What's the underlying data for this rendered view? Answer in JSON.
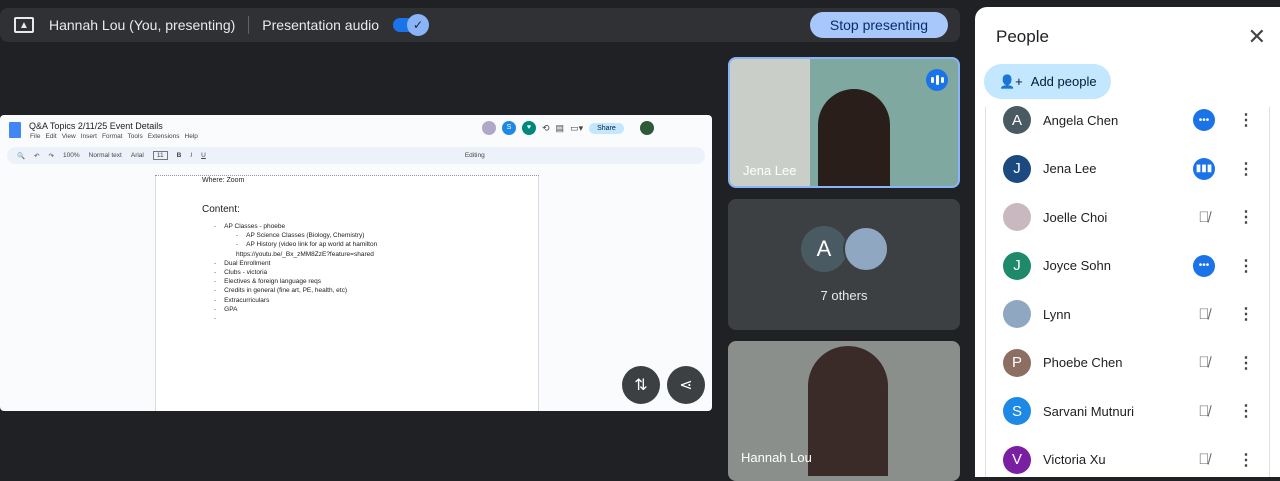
{
  "topbar": {
    "presenter": "Hannah Lou (You, presenting)",
    "audio_label": "Presentation audio",
    "audio_on": true,
    "stop_label": "Stop presenting"
  },
  "doc": {
    "title": "Q&A Topics 2/11/25 Event Details",
    "menus": [
      "File",
      "Edit",
      "View",
      "Insert",
      "Format",
      "Tools",
      "Extensions",
      "Help"
    ],
    "zoom": "100%",
    "style": "Normal text",
    "font": "Arial",
    "font_size": "11",
    "mode": "Editing",
    "share": "Share",
    "collab_initial": "S",
    "where": "Where: Zoom",
    "heading": "Content:",
    "items": [
      {
        "text": "AP Classes - phoebe",
        "level": 1
      },
      {
        "text": "AP Science Classes (Biology, Chemistry)",
        "level": 2
      },
      {
        "text": "AP History (video link for ap world at hamilton",
        "level": 2
      },
      {
        "text": "https://youtu.be/_Bx_zMM8ZzE?feature=shared",
        "level": "cont"
      },
      {
        "text": "Dual Enrollment",
        "level": 1
      },
      {
        "text": "Clubs - victoria",
        "level": 1
      },
      {
        "text": "Electives & foreign language reqs",
        "level": 1
      },
      {
        "text": "Credits in general (fine art, PE, health, etc)",
        "level": 1
      },
      {
        "text": "Extracurriculars",
        "level": 1
      },
      {
        "text": "GPA",
        "level": 1
      },
      {
        "text": "",
        "level": 1
      }
    ]
  },
  "tiles": {
    "jena": "Jena Lee",
    "others_initial": "A",
    "others": "7 others",
    "hannah": "Hannah Lou"
  },
  "panel": {
    "title": "People",
    "add": "Add people",
    "participants": [
      {
        "name": "Angela Chen",
        "initial": "A",
        "color": "#4a5a63",
        "status": "dots"
      },
      {
        "name": "Jena Lee",
        "initial": "J",
        "color": "#1b4a80",
        "status": "speaking"
      },
      {
        "name": "Joelle Choi",
        "initial": "",
        "color": "#c9b8c0",
        "status": "muted"
      },
      {
        "name": "Joyce Sohn",
        "initial": "J",
        "color": "#1e8a6a",
        "status": "dots"
      },
      {
        "name": "Lynn",
        "initial": "",
        "color": "#8fa7c0",
        "status": "muted"
      },
      {
        "name": "Phoebe Chen",
        "initial": "P",
        "color": "#8d6e63",
        "status": "muted"
      },
      {
        "name": "Sarvani Mutnuri",
        "initial": "S",
        "color": "#1e88e5",
        "status": "muted"
      },
      {
        "name": "Victoria Xu",
        "initial": "V",
        "color": "#7b1fa2",
        "status": "muted"
      }
    ]
  }
}
